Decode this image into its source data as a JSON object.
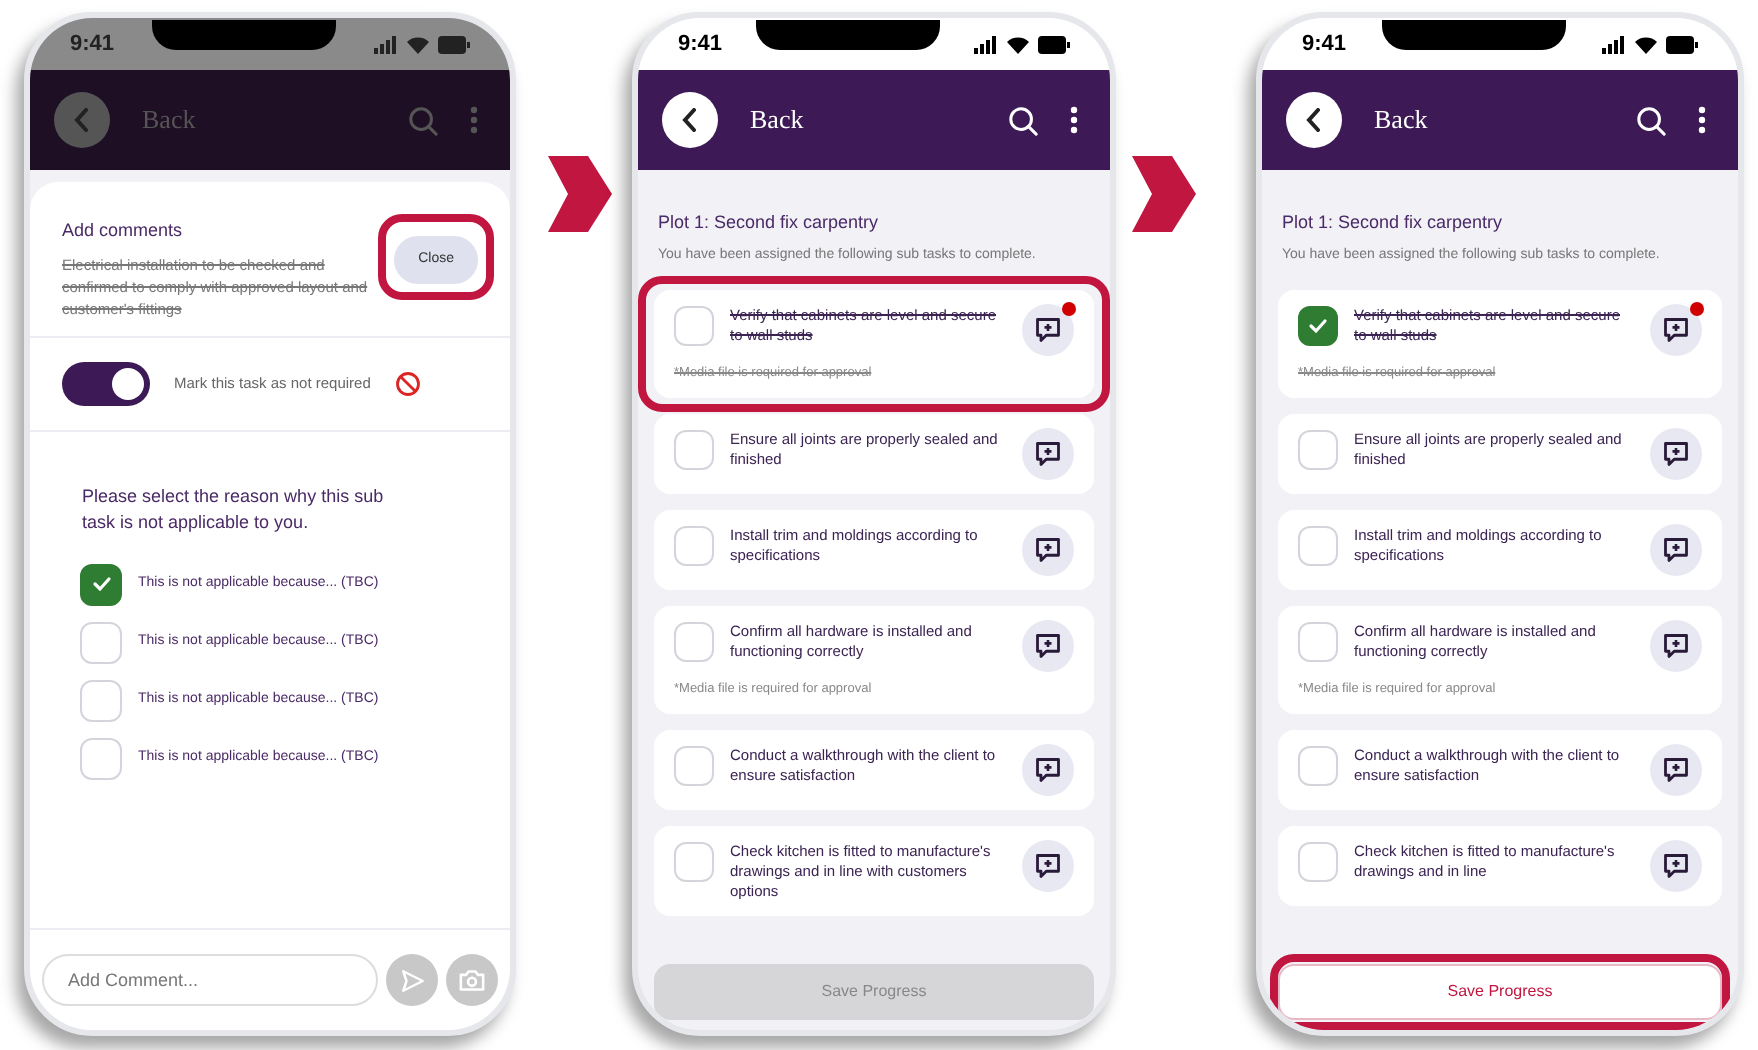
{
  "screens": [
    {
      "kind": "comment_sheet",
      "time": "9:41",
      "back_label": "Back",
      "dimmed": true,
      "sheet": {
        "title": "Add comments",
        "close_label": "Close",
        "close_highlighted": true,
        "task_text": "Electrical installation to be checked and confirmed to comply with approved layout and customer's fittings",
        "task_struck": true,
        "toggle": {
          "label": "Mark this task as not required",
          "on": true
        },
        "prompt": "Please select the reason why this sub task is not applicable to you.",
        "reasons": [
          {
            "label": "This is not applicable because... (TBC)",
            "checked": true
          },
          {
            "label": "This is not applicable because... (TBC)",
            "checked": false
          },
          {
            "label": "This is not applicable because... (TBC)",
            "checked": false
          },
          {
            "label": "This is not applicable because... (TBC)",
            "checked": false
          }
        ],
        "comment_placeholder": "Add Comment..."
      }
    },
    {
      "kind": "task_list",
      "time": "9:41",
      "back_label": "Back",
      "dimmed": false,
      "plot_title": "Plot 1: Second fix carpentry",
      "subtitle": "You have been assigned the following sub tasks to complete.",
      "tasks": [
        {
          "text": "Verify that cabinets are level and secure to wall studs",
          "note": "*Media file is required for approval",
          "checked": false,
          "struck": true,
          "unread": true,
          "highlighted": true
        },
        {
          "text": "Ensure all joints are properly sealed and finished",
          "checked": false,
          "struck": false,
          "unread": false,
          "highlighted": false
        },
        {
          "text": "Install trim and moldings according to specifications",
          "checked": false,
          "struck": false,
          "unread": false,
          "highlighted": false
        },
        {
          "text": "Confirm all hardware is installed and functioning correctly",
          "note": "*Media file is required for approval",
          "checked": false,
          "struck": false,
          "unread": false,
          "highlighted": false
        },
        {
          "text": "Conduct a walkthrough with the client to ensure satisfaction",
          "checked": false,
          "struck": false,
          "unread": false,
          "highlighted": false
        },
        {
          "text": "Check kitchen is fitted to manufacture's drawings and in line with customers options",
          "checked": false,
          "struck": false,
          "unread": false,
          "highlighted": false
        }
      ],
      "save_label": "Save Progress",
      "save_enabled": false,
      "save_highlighted": false
    },
    {
      "kind": "task_list",
      "time": "9:41",
      "back_label": "Back",
      "dimmed": false,
      "plot_title": "Plot 1: Second fix carpentry",
      "subtitle": "You have been assigned the following sub tasks to complete.",
      "tasks": [
        {
          "text": "Verify that cabinets are level and secure to wall studs",
          "note": "*Media file is required for approval",
          "checked": true,
          "struck": true,
          "unread": true,
          "highlighted": false
        },
        {
          "text": "Ensure all joints are properly sealed and finished",
          "checked": false,
          "struck": false,
          "unread": false,
          "highlighted": false
        },
        {
          "text": "Install trim and moldings according to specifications",
          "checked": false,
          "struck": false,
          "unread": false,
          "highlighted": false
        },
        {
          "text": "Confirm all hardware is installed and functioning correctly",
          "note": "*Media file is required for approval",
          "checked": false,
          "struck": false,
          "unread": false,
          "highlighted": false
        },
        {
          "text": "Conduct a walkthrough with the client to ensure satisfaction",
          "checked": false,
          "struck": false,
          "unread": false,
          "highlighted": false
        },
        {
          "text": "Check kitchen is fitted to manufacture's drawings and in line",
          "checked": false,
          "struck": false,
          "unread": false,
          "highlighted": false
        }
      ],
      "save_label": "Save Progress",
      "save_enabled": true,
      "save_highlighted": true
    }
  ]
}
